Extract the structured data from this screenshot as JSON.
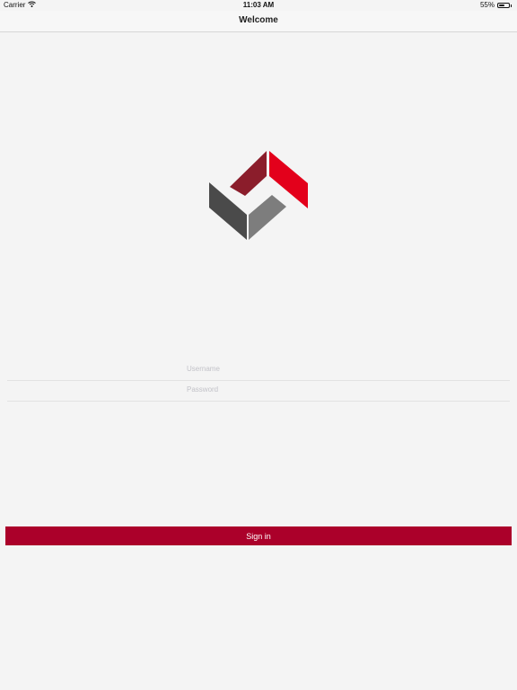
{
  "status_bar": {
    "carrier": "Carrier",
    "time": "11:03 AM",
    "battery": "55%",
    "battery_level": 0.55
  },
  "nav": {
    "title": "Welcome"
  },
  "logo": {
    "colors": {
      "dark_red": "#8b1d2b",
      "bright_red": "#e3001b",
      "dark_gray": "#4a4a4a",
      "light_gray": "#7d7d7d"
    }
  },
  "form": {
    "username_placeholder": "Username",
    "username_value": "",
    "password_placeholder": "Password",
    "password_value": "",
    "sign_in_label": "Sign in"
  },
  "colors": {
    "accent": "#ab002a",
    "background": "#f4f4f4"
  }
}
